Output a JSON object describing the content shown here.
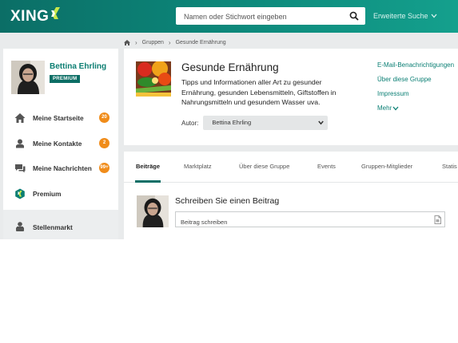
{
  "header": {
    "logo_text": "XING",
    "search_placeholder": "Namen oder Stichwort eingeben",
    "advanced_search": "Erweiterte Suche"
  },
  "breadcrumb": {
    "items": [
      "Gruppen",
      "Gesunde Ernährung"
    ]
  },
  "sidebar": {
    "profile": {
      "name": "Bettina Ehrling",
      "badge": "PREMIUM"
    },
    "items": [
      {
        "label": "Meine Startseite",
        "count": "20",
        "icon": "home-icon"
      },
      {
        "label": "Meine Kontakte",
        "count": "2",
        "icon": "contacts-icon"
      },
      {
        "label": "Meine Nachrichten",
        "count": "99+",
        "icon": "messages-icon"
      },
      {
        "label": "Premium",
        "count": "",
        "icon": "premium-icon"
      }
    ],
    "jobs_label": "Stellenmarkt"
  },
  "group": {
    "title": "Gesunde Ernährung",
    "description": "Tipps und Informationen aller Art zu gesunder Ernährung, gesunden Lebensmitteln, Giftstoffen in Nahrungsmitteln und gesundem Wasser uva.",
    "author_label": "Autor:",
    "author_value": "Bettina Ehrling",
    "links": {
      "email": "E-Mail-Benachrichtigungen",
      "about": "Über diese Gruppe",
      "imprint": "Impressum",
      "more": "Mehr"
    }
  },
  "tabs": [
    "Beiträge",
    "Marktplatz",
    "Über diese Gruppe",
    "Events",
    "Gruppen-Mitglieder",
    "Statis"
  ],
  "composer": {
    "title": "Schreiben Sie einen Beitrag",
    "placeholder": "Beitrag schreiben"
  },
  "colors": {
    "brand": "#0b7f74",
    "badge": "#0c6e65",
    "counter": "#f08c1a"
  }
}
